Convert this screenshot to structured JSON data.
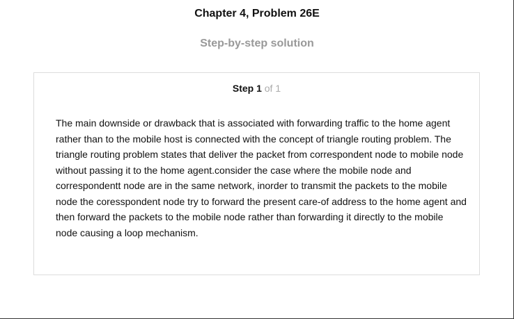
{
  "header": {
    "chapter_title": "Chapter 4, Problem 26E",
    "subtitle": "Step-by-step solution"
  },
  "step": {
    "label": "Step 1",
    "total": "of 1",
    "body": "The main downside or drawback that is associated with forwarding traffic to the home agent rather than to the mobile host is connected with the concept of triangle routing problem. The triangle routing problem states that deliver the packet from correspondent node to mobile node without passing it to the home agent.consider the case where the mobile node and correspondentt node are in the same network, inorder to transmit the packets to the mobile node the coresspondent node try to forward the present care-of address to the home agent and then forward the packets to the mobile node rather than forwarding it directly to the mobile node causing a loop mechanism."
  }
}
